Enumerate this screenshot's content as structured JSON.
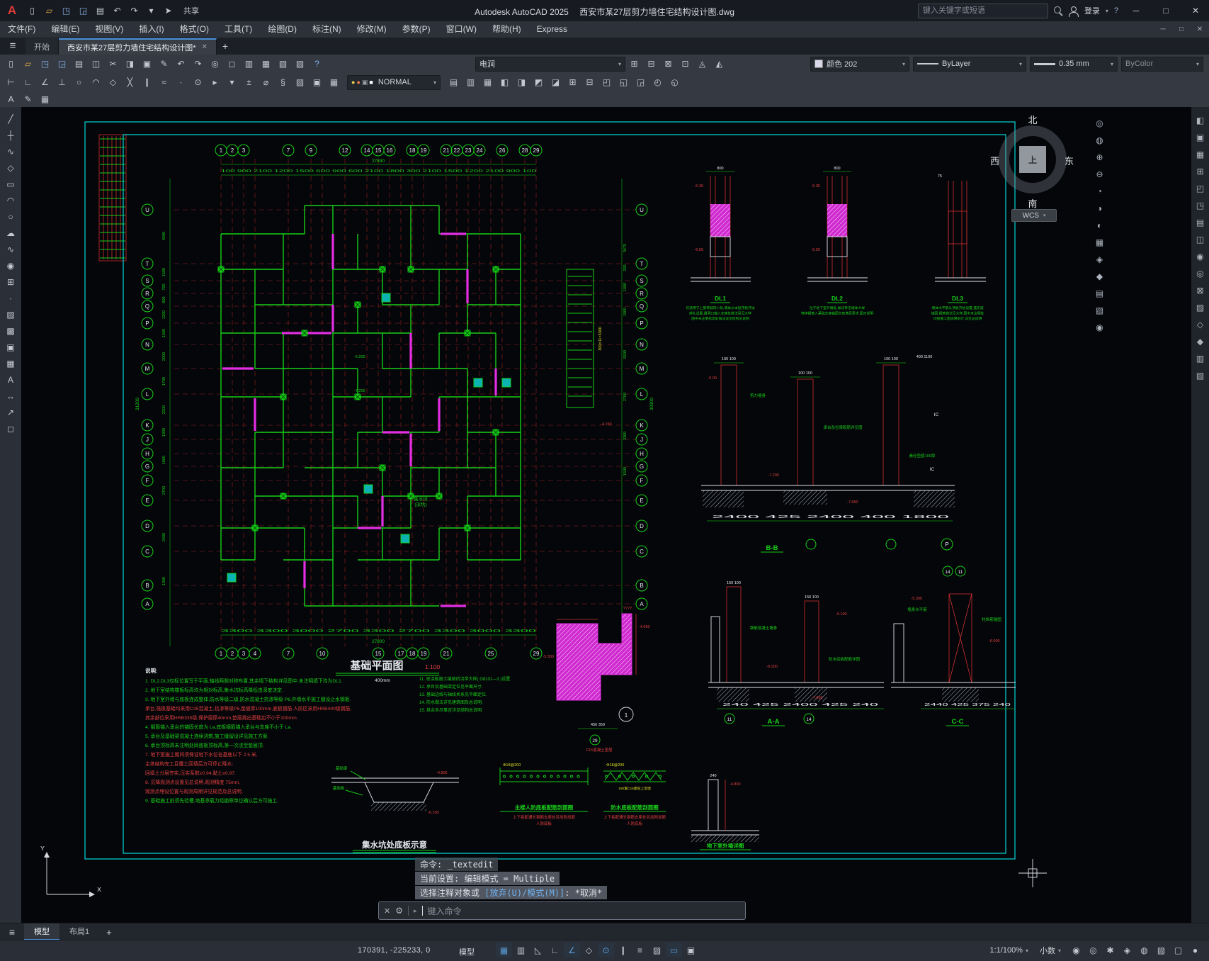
{
  "ui": {
    "caret": "▾",
    "hamburger": "≡",
    "divider": "|",
    "arrow": "▸"
  },
  "titlebar": {
    "logo": "A",
    "title_app": "Autodesk AutoCAD 2025",
    "title_doc": "西安市某27层剪力墙住宅结构设计图.dwg",
    "search_placeholder": "键入关键字或短语",
    "share": "共享",
    "login": "登录",
    "help": "?",
    "window": {
      "min": "─",
      "max": "□",
      "close": "✕"
    }
  },
  "qat_icons": [
    {
      "n": "new-file-icon",
      "g": "▯"
    },
    {
      "n": "open-folder-icon",
      "g": "▱",
      "c": "#d8a847"
    },
    {
      "n": "save-icon",
      "g": "◳",
      "c": "#8ab4e8"
    },
    {
      "n": "save-as-icon",
      "g": "◲",
      "c": "#8ab4e8"
    },
    {
      "n": "plot-icon",
      "g": "▤"
    },
    {
      "n": "undo-icon",
      "g": "↶"
    },
    {
      "n": "redo-icon",
      "g": "↷"
    },
    {
      "n": "qat-dropdown-icon",
      "g": "▾"
    },
    {
      "n": "share-plane-icon",
      "g": "➤"
    }
  ],
  "menubar": {
    "items": [
      "文件(F)",
      "编辑(E)",
      "视图(V)",
      "插入(I)",
      "格式(O)",
      "工具(T)",
      "绘图(D)",
      "标注(N)",
      "修改(M)",
      "参数(P)",
      "窗口(W)",
      "帮助(H)",
      "Express"
    ]
  },
  "filetabs": {
    "start": "开始",
    "doc": "西安市某27层剪力墙住宅结构设计图*",
    "close": "✕",
    "add": "+"
  },
  "toolbar1": {
    "icons_left": [
      {
        "n": "qnew-icon",
        "g": "▯"
      },
      {
        "n": "open-icon",
        "g": "▱",
        "c": "#d8a847"
      },
      {
        "n": "save-icon",
        "g": "◳",
        "c": "#8ab4e8"
      },
      {
        "n": "saveas-icon",
        "g": "◲",
        "c": "#8ab4e8"
      },
      {
        "n": "plot-icon",
        "g": "▤"
      },
      {
        "n": "preview-icon",
        "g": "◫"
      },
      {
        "n": "cut-icon",
        "g": "✂"
      },
      {
        "n": "copy-icon",
        "g": "◨"
      },
      {
        "n": "paste-icon",
        "g": "▣"
      },
      {
        "n": "matchprop-icon",
        "g": "✎"
      },
      {
        "n": "undo-icon",
        "g": "↶"
      },
      {
        "n": "redo-icon",
        "g": "↷"
      },
      {
        "n": "pan-icon",
        "g": "◎"
      },
      {
        "n": "zoom-window-icon",
        "g": "◻"
      },
      {
        "n": "properties-icon",
        "g": "▥"
      },
      {
        "n": "designcenter-icon",
        "g": "▦"
      },
      {
        "n": "toolpalettes-icon",
        "g": "▧"
      },
      {
        "n": "sheetset-icon",
        "g": "▨"
      },
      {
        "n": "help-icon",
        "g": "?",
        "c": "#7db1e8"
      }
    ],
    "combo_value": "电涧",
    "icons_mid": [
      {
        "n": "draworder-icon",
        "g": "⊞"
      },
      {
        "n": "annotate-icon",
        "g": "⊟"
      },
      {
        "n": "measure-icon",
        "g": "⊠"
      },
      {
        "n": "quickcalc-icon",
        "g": "⊡"
      },
      {
        "n": "render-icon",
        "g": "◬"
      },
      {
        "n": "materials-icon",
        "g": "◭"
      }
    ],
    "color_combo": "颜色 202",
    "linetype_combo": "ByLayer",
    "lineweight_combo": "0.35 mm",
    "plotstyle_combo": "ByColor"
  },
  "toolbar2": {
    "icons_left": [
      {
        "n": "osnap-endpoint-icon",
        "g": "⊢"
      },
      {
        "n": "osnap-midpoint-icon",
        "g": "∟"
      },
      {
        "n": "osnap-angle-icon",
        "g": "∠"
      },
      {
        "n": "osnap-perpendicular-icon",
        "g": "⊥"
      },
      {
        "n": "osnap-center-icon",
        "g": "○"
      },
      {
        "n": "osnap-arc-icon",
        "g": "◠"
      },
      {
        "n": "osnap-quadrant-icon",
        "g": "◇"
      },
      {
        "n": "osnap-intersection-icon",
        "g": "╳"
      },
      {
        "n": "osnap-parallel-icon",
        "g": "∥"
      },
      {
        "n": "osnap-nearest-icon",
        "g": "≈"
      },
      {
        "n": "osnap-node-icon",
        "g": "∙"
      },
      {
        "n": "osnap-tangent-icon",
        "g": "⊙"
      },
      {
        "n": "snap-next-icon",
        "g": "▸"
      },
      {
        "n": "snap-settings-icon",
        "g": "▾"
      },
      {
        "n": "tolerance-icon",
        "g": "±"
      },
      {
        "n": "diameter-icon",
        "g": "⌀"
      },
      {
        "n": "section-icon",
        "g": "§"
      },
      {
        "n": "hatch-tool-icon",
        "g": "▨"
      },
      {
        "n": "region-tool-icon",
        "g": "▣"
      },
      {
        "n": "group-icon",
        "g": "▦"
      }
    ],
    "layer_icons": [
      {
        "n": "layer-on-icon",
        "g": "●",
        "c": "#e8d44d"
      },
      {
        "n": "layer-freeze-icon",
        "g": "●",
        "c": "#e87c4d"
      },
      {
        "n": "layer-lock-icon",
        "g": "▣",
        "c": "#9aa2ab"
      },
      {
        "n": "layer-color-chip",
        "g": "■",
        "c": "#ffffff"
      }
    ],
    "layer_value": "NORMAL",
    "icons_right": [
      {
        "n": "layer-properties-icon",
        "g": "▤"
      },
      {
        "n": "layer-states-icon",
        "g": "▥"
      },
      {
        "n": "layer-walk-icon",
        "g": "▦"
      },
      {
        "n": "layer-freeze-all-icon",
        "g": "◧"
      },
      {
        "n": "layer-off-icon",
        "g": "◨"
      },
      {
        "n": "layer-isolate-icon",
        "g": "◩"
      },
      {
        "n": "layer-unisolate-icon",
        "g": "◪"
      },
      {
        "n": "make-block-icon",
        "g": "⊞"
      },
      {
        "n": "explode-icon",
        "g": "⊟"
      },
      {
        "n": "move-icon",
        "g": "◰"
      },
      {
        "n": "rotate-icon",
        "g": "◱"
      },
      {
        "n": "mirror-icon",
        "g": "◲"
      },
      {
        "n": "array-icon",
        "g": "◴"
      },
      {
        "n": "offset-icon",
        "g": "◵"
      }
    ]
  },
  "toolbar3": {
    "icons": [
      {
        "n": "text-style-icon",
        "g": "A"
      },
      {
        "n": "dim-style-icon",
        "g": "✎"
      },
      {
        "n": "table-style-icon",
        "g": "▦"
      }
    ]
  },
  "left_toolbar": {
    "icons": [
      {
        "n": "line-icon",
        "g": "╱"
      },
      {
        "n": "construction-line-icon",
        "g": "┼"
      },
      {
        "n": "polyline-icon",
        "g": "∿"
      },
      {
        "n": "polygon-icon",
        "g": "◇"
      },
      {
        "n": "rectangle-icon",
        "g": "▭"
      },
      {
        "n": "arc-icon",
        "g": "◠"
      },
      {
        "n": "circle-icon",
        "g": "○"
      },
      {
        "n": "revcloud-icon",
        "g": "☁"
      },
      {
        "n": "spline-icon",
        "g": "∿"
      },
      {
        "n": "ellipse-icon",
        "g": "◉"
      },
      {
        "n": "insert-block-icon",
        "g": "⊞"
      },
      {
        "n": "point-icon",
        "g": "∙"
      },
      {
        "n": "hatch-icon",
        "g": "▨"
      },
      {
        "n": "gradient-icon",
        "g": "▩"
      },
      {
        "n": "region-icon",
        "g": "▣"
      },
      {
        "n": "table-icon",
        "g": "▦"
      },
      {
        "n": "mtext-icon",
        "g": "A"
      },
      {
        "n": "dimension-icon",
        "g": "↔"
      },
      {
        "n": "leader-icon",
        "g": "↗"
      },
      {
        "n": "erase-icon",
        "g": "◻"
      }
    ]
  },
  "right_navbar": {
    "icons": [
      {
        "n": "steering-wheel-icon",
        "g": "◎"
      },
      {
        "n": "pan-hand-icon",
        "g": "◍"
      },
      {
        "n": "zoom-extents-icon",
        "g": "⊕"
      },
      {
        "n": "zoom-out-icon",
        "g": "⊖"
      },
      {
        "n": "orbit-icon",
        "g": "◔"
      },
      {
        "n": "showmotion-icon",
        "g": "◑"
      },
      {
        "n": "viewback-icon",
        "g": "◐"
      },
      {
        "n": "grid-nav-icon",
        "g": "▦"
      },
      {
        "n": "gem-icon",
        "g": "◈"
      },
      {
        "n": "diamond-icon",
        "g": "◆"
      },
      {
        "n": "sheet-nav-icon",
        "g": "▤"
      },
      {
        "n": "layers-nav-icon",
        "g": "▧"
      },
      {
        "n": "target-icon",
        "g": "◉"
      }
    ]
  },
  "right_dock": {
    "icons": [
      {
        "n": "dock-measure-icon",
        "g": "◧"
      },
      {
        "n": "dock-paste-icon",
        "g": "▣"
      },
      {
        "n": "dock-grid-icon",
        "g": "▦"
      },
      {
        "n": "dock-block-icon",
        "g": "⊞"
      },
      {
        "n": "dock-corner-icon",
        "g": "◰"
      },
      {
        "n": "dock-save-icon",
        "g": "◳"
      },
      {
        "n": "dock-sheet-icon",
        "g": "▤"
      },
      {
        "n": "dock-split-icon",
        "g": "◫"
      },
      {
        "n": "dock-target-icon",
        "g": "◉"
      },
      {
        "n": "dock-wheel-icon",
        "g": "◎"
      },
      {
        "n": "dock-close-icon",
        "g": "⊠"
      },
      {
        "n": "dock-hatch-icon",
        "g": "▨"
      },
      {
        "n": "dock-poly-icon",
        "g": "◇"
      },
      {
        "n": "dock-solid-icon",
        "g": "◆"
      },
      {
        "n": "dock-props-icon",
        "g": "▥"
      },
      {
        "n": "dock-palette-icon",
        "g": "▧"
      }
    ]
  },
  "viewcube": {
    "n": "北",
    "e": "东",
    "s": "南",
    "w": "西",
    "center": "上",
    "wcs": "WCS"
  },
  "cmd": {
    "line1": "命令: _textedit",
    "line2": "当前设置: 编辑模式 = Multiple",
    "line3_pre": "选择注释对象或 ",
    "line3_opts": "[放弃(U)/模式(M)]",
    "line3_suf": ": *取消*",
    "placeholder": "键入命令"
  },
  "layout_tabs": {
    "model": "模型",
    "layout1": "布局1",
    "add": "+"
  },
  "statusbar": {
    "coords": "170391, -225233, 0",
    "model": "模型",
    "left_icons": [
      {
        "n": "grid-icon",
        "g": "▦",
        "on": true
      },
      {
        "n": "snap-icon",
        "g": "▥"
      },
      {
        "n": "infer-icon",
        "g": "◺"
      },
      {
        "n": "ortho-icon",
        "g": "∟"
      },
      {
        "n": "polar-icon",
        "g": "∠",
        "on": true
      },
      {
        "n": "isodraft-icon",
        "g": "◇"
      },
      {
        "n": "osnap-icon",
        "g": "⊙",
        "on": true
      },
      {
        "n": "otrack-icon",
        "g": "∥"
      },
      {
        "n": "lineweight-icon",
        "g": "≡"
      },
      {
        "n": "transparency-icon",
        "g": "▨"
      },
      {
        "n": "dynamic-input-icon",
        "g": "▭",
        "on": true
      },
      {
        "n": "selection-cycling-icon",
        "g": "▣"
      }
    ],
    "scale": "1:1/100%",
    "units": "小数",
    "right_icons": [
      {
        "n": "annotation-visibility-icon",
        "g": "◉"
      },
      {
        "n": "autoscale-icon",
        "g": "◎"
      },
      {
        "n": "workspace-gear-icon",
        "g": "✱"
      },
      {
        "n": "annotation-monitor-icon",
        "g": "◈"
      },
      {
        "n": "object-isolate-icon",
        "g": "◍"
      },
      {
        "n": "graphics-performance-icon",
        "g": "▧"
      },
      {
        "n": "clean-screen-icon",
        "g": "▢"
      },
      {
        "n": "notification-bell-icon",
        "g": "●"
      }
    ]
  },
  "sheet": {
    "plan": {
      "bubbles_top": [
        "1",
        "2",
        "3",
        "7",
        "9",
        "12",
        "14",
        "15",
        "16",
        "18",
        "19",
        "21",
        "22",
        "23",
        "24",
        "26",
        "28",
        "29"
      ],
      "bubbles_bottom": [
        "1",
        "2",
        "3",
        "4",
        "7",
        "10",
        "15",
        "17",
        "18",
        "19",
        "21",
        "25",
        "29"
      ],
      "letters": [
        "U",
        "T",
        "S",
        "R",
        "Q",
        "P",
        "N",
        "M",
        "L",
        "K",
        "J",
        "H",
        "G",
        "F",
        "E",
        "D",
        "C",
        "B",
        "A"
      ],
      "dims_top": "100 900 2100 1200 1500 600 900 600 2100 1800 300 2100 1500 1200 2100 900 100",
      "total_top": "27890",
      "dims_bottom": "3300  3300  3000  2700  3300  2700  3300  3000  3300",
      "total_bottom": "27800",
      "dims_left": [
        "4500",
        "1500",
        "700",
        "800",
        "1200",
        "1500",
        "2000",
        "1700",
        "2200",
        "1300",
        "1800",
        "2700",
        "2400",
        "1300"
      ],
      "dims_right": [
        "3475",
        "250",
        "1800",
        "1900",
        "5500",
        "2700",
        "3300",
        "1500"
      ],
      "total_left": "31200",
      "total_right": "30300",
      "stair_dim": "300×11=3300",
      "elev1": "-6.200",
      "elev2": "-7.200",
      "elev3": "-4.150",
      "sump_label": "集水坑",
      "sump_label2": "(深坑)"
    },
    "title": {
      "name": "基础平面图",
      "scale": "1:100",
      "sub": "400mm"
    },
    "dl1": {
      "label": "DL1",
      "dim": "800",
      "e1": "-5.30",
      "e2": "-6.50",
      "notes": [
        "仅适用于上部荷载较小处,墙体从本层顶板开始",
        "绑扎设置,遇洞口锚入支座处做法另见大样",
        "图中未注明标高处做法详见结构总说明"
      ]
    },
    "dl2": {
      "label": "DL2",
      "dim": "800",
      "e1": "-5.30",
      "e2": "-6.50",
      "notes": [
        "位于地下室外墙处,做法参见墙体大样",
        "墙体钢筋入基础支座锚固长度满足要求,图示说明"
      ]
    },
    "dl3": {
      "label": "DL3",
      "dim": "75",
      "notes": [
        "墙体水平筋从顶板开始设置,遇支座",
        "锚固,钢筋做法见大样,图中未注明处",
        "均按施工图说明执行,详见总说明"
      ]
    },
    "bb": {
      "label": "B-B",
      "d1": "100 100",
      "d2": "100 100",
      "d3": "100 100",
      "d4": "400  1100",
      "chain": "2400      425      2400      400      1800",
      "e1": "-6.00",
      "e2": "-7.200",
      "e3": "-7.650",
      "ic1": "IC",
      "ic2": "IC",
      "bub": "P",
      "n1": "剪力墙身",
      "n2": "承台及拉梁配筋详见图",
      "n3": "素砼垫层100厚"
    },
    "aa": {
      "label": "A-A",
      "d1": "150 100",
      "d2": "150 100",
      "chain": "240   425   2400   425   240",
      "e1": "-6.100",
      "e2": "-6.200",
      "e3": "-7.650",
      "b1": "11",
      "b2": "14",
      "n1": "钢筋混凝土墙身",
      "n2": "防水底板配筋详图"
    },
    "cc": {
      "label": "C-C",
      "chain": "2440  425  375  240",
      "e1": "-5.300",
      "e2": "-6.900",
      "b1": "14",
      "b2": "11",
      "n1": "墙身水平筋",
      "n2": "柱纵筋锚固"
    },
    "step": {
      "e1": "-4.650",
      "e2": "-5.300",
      "q": "????",
      "d": "450 350",
      "bub1": "1",
      "bub2": "29",
      "note": "C15混凝土垫层"
    },
    "slab1": {
      "label": "主楼人防底板配筋剖面图",
      "rebar": "Φ18@200",
      "s1": "上下各配通长钢筋支座处另加附加筋",
      "s2": "人防底板"
    },
    "slab2": {
      "label": "防水底板配筋剖面图",
      "rebar": "Φ18@200",
      "note": "150宽C15素砼上反墙",
      "s1": "上下各配通长钢筋支座处另加附加筋",
      "s2": "人防底板"
    },
    "wall": {
      "label": "地下室外墙详图",
      "e1": "-4.800",
      "d1": "240"
    },
    "sump": {
      "label": "集水坑处底板示意",
      "e1": "-4.800",
      "e2": "-6.100",
      "l1": "基础梁",
      "l2": "基础板"
    },
    "notes": {
      "title": "说明:",
      "col1": [
        {
          "c": "g",
          "t": "1. DL2,DL3仅标位置写于平面,轴线两侧对称布置,其余墙下结构详见图中,未注明墙下均为DL1."
        },
        {
          "c": "g",
          "t": "2. 地下室结构楼板标高均为相对标高,集水坑标高降低由深度决定."
        },
        {
          "c": "g",
          "t": "3. 地下室外墙与底板连成整体,防水等级二级,防水混凝土抗渗等级 P6,外墙水平施工缝设止水钢板."
        },
        {
          "c": "r",
          "t": "   承台,筏板基础均采用C35混凝土,抗渗等级P6,垫层厚100mm,底板钢筋:人防区采用HRB400级钢筋,"
        },
        {
          "c": "r",
          "t": "   其余部位采用HRB335级,保护层厚40mm,垫层挑出基础边不小于100mm."
        },
        {
          "c": "g",
          "t": "4. 钢筋锚入承台的锚固长度为 La,底板钢筋锚入承台与支座不小于 La."
        },
        {
          "c": "g",
          "t": "5. 承台及基础梁混凝土连续浇筑,施工缝留设详见施工方案."
        },
        {
          "c": "g",
          "t": "6. 承台顶标高未注明处同底板顶标高,第一次浇至垫层顶."
        },
        {
          "c": "r",
          "t": "7. 地下室施工期间须保证地下水位在基底以下 2.5 米,"
        },
        {
          "c": "r",
          "t": "   主体结构完工且覆土回填后方可停止降水;"
        },
        {
          "c": "r",
          "t": "   回填土分层夯实,压实系数≥0.94,黏土≥0.97."
        },
        {
          "c": "r",
          "t": "8. 沉降观测点设置见总说明,观测精度 75mm,"
        },
        {
          "c": "r",
          "t": "   观测点埋设位置与观测周期详见规范及总说明."
        },
        {
          "c": "g",
          "t": "9. 基础施工前须先验槽,地基承载力经勘察单位确认后方可施工."
        }
      ],
      "col2": [
        {
          "c": "g",
          "t": "11. 现浇板施工缝按后浇带大样( G8101—3 )设置."
        },
        {
          "c": "g",
          "t": "12. 承台及基础梁定位见平面尺寸."
        },
        {
          "c": "g",
          "t": "13. 基础边线与轴线关系见平面定位."
        },
        {
          "c": "g",
          "t": "14. 防水做法详见建筑图及总说明."
        },
        {
          "c": "g",
          "t": "15. 其余未尽事宜详见结构总说明."
        }
      ]
    }
  }
}
